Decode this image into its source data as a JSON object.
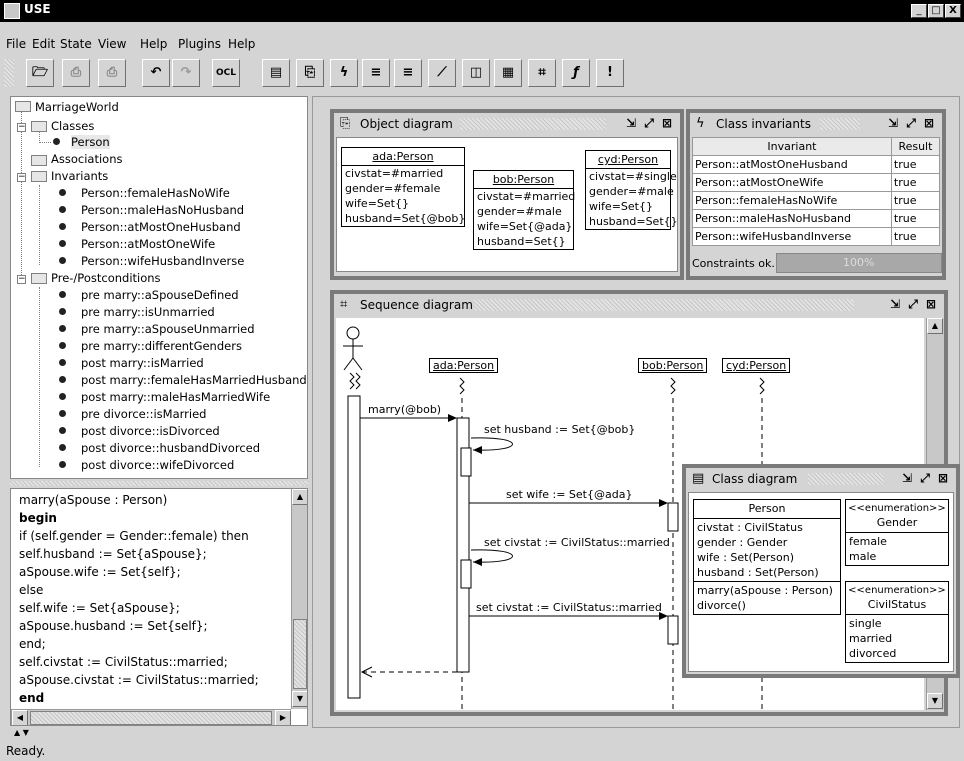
{
  "window": {
    "title": "USE",
    "min": "_",
    "max": "□",
    "close": "X"
  },
  "menu": [
    "File",
    "Edit",
    "State",
    "View",
    "Help",
    "Plugins",
    "Help"
  ],
  "toolbar": {
    "ocl": "OCL"
  },
  "tree": {
    "root": "MarriageWorld",
    "classes": "Classes",
    "person": "Person",
    "associations": "Associations",
    "invariants": "Invariants",
    "inv_items": [
      "Person::femaleHasNoWife",
      "Person::maleHasNoHusband",
      "Person::atMostOneHusband",
      "Person::atMostOneWife",
      "Person::wifeHusbandInverse"
    ],
    "prepost": "Pre-/Postconditions",
    "prepost_items": [
      "pre marry::aSpouseDefined",
      "pre marry::isUnmarried",
      "pre marry::aSpouseUnmarried",
      "pre marry::differentGenders",
      "post marry::isMarried",
      "post marry::femaleHasMarriedHusband",
      "post marry::maleHasMarriedWife",
      "pre divorce::isMarried",
      "post divorce::isDivorced",
      "post divorce::husbandDivorced",
      "post divorce::wifeDivorced"
    ]
  },
  "code": [
    "marry(aSpouse : Person)",
    "  begin",
    "   if (self.gender = Gender::female) then",
    "     self.husband := Set{aSpouse};",
    "     aSpouse.wife := Set{self};",
    "   else",
    "     self.wife := Set{aSpouse};",
    "     aSpouse.husband := Set{self};",
    "   end;",
    "   self.civstat := CivilStatus::married;",
    "   aSpouse.civstat := CivilStatus::married;",
    "  end"
  ],
  "object_diagram": {
    "title": "Object diagram",
    "objects": [
      {
        "name": "ada:Person",
        "attrs": [
          "civstat=#married",
          "gender=#female",
          "wife=Set{}",
          "husband=Set{@bob}"
        ]
      },
      {
        "name": "bob:Person",
        "attrs": [
          "civstat=#married",
          "gender=#male",
          "wife=Set{@ada}",
          "husband=Set{}"
        ]
      },
      {
        "name": "cyd:Person",
        "attrs": [
          "civstat=#single",
          "gender=#male",
          "wife=Set{}",
          "husband=Set{}"
        ]
      }
    ]
  },
  "class_invariants": {
    "title": "Class invariants",
    "headers": [
      "Invariant",
      "Result"
    ],
    "rows": [
      [
        "Person::atMostOneHusband",
        "true"
      ],
      [
        "Person::atMostOneWife",
        "true"
      ],
      [
        "Person::femaleHasNoWife",
        "true"
      ],
      [
        "Person::maleHasNoHusband",
        "true"
      ],
      [
        "Person::wifeHusbandInverse",
        "true"
      ]
    ],
    "status": "Constraints ok.",
    "progress_label": "100%",
    "progress": 1.0
  },
  "sequence_diagram": {
    "title": "Sequence diagram",
    "lifelines": [
      "ada:Person",
      "bob:Person",
      "cyd:Person"
    ],
    "messages": [
      "marry(@bob)",
      "set husband := Set{@bob}",
      "set wife := Set{@ada}",
      "set civstat := CivilStatus::married",
      "set civstat := CivilStatus::married"
    ]
  },
  "class_diagram": {
    "title": "Class diagram",
    "person": {
      "name": "Person",
      "attrs": [
        "civstat : CivilStatus",
        "gender : Gender",
        "wife : Set(Person)",
        "husband : Set(Person)"
      ],
      "ops": [
        "marry(aSpouse : Person)",
        "divorce()"
      ]
    },
    "gender": {
      "stereo": "<<enumeration>>",
      "name": "Gender",
      "values": [
        "female",
        "male"
      ]
    },
    "civil": {
      "stereo": "<<enumeration>>",
      "name": "CivilStatus",
      "values": [
        "single",
        "married",
        "divorced"
      ]
    }
  },
  "status_bar": "Ready."
}
